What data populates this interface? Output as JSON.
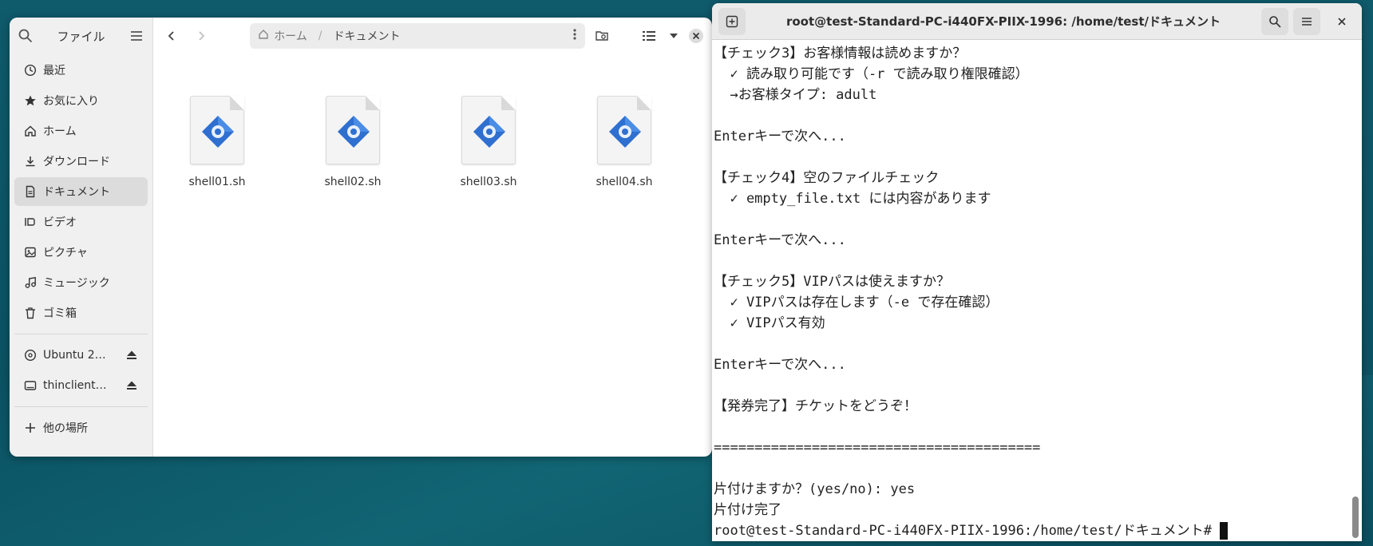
{
  "file_manager": {
    "sidebar": {
      "title": "ファイル",
      "places": [
        {
          "label": "最近",
          "icon": "clock-icon",
          "active": false
        },
        {
          "label": "お気に入り",
          "icon": "star-icon",
          "active": false
        },
        {
          "label": "ホーム",
          "icon": "home-icon",
          "active": false
        },
        {
          "label": "ダウンロード",
          "icon": "download-icon",
          "active": false
        },
        {
          "label": "ドキュメント",
          "icon": "document-icon",
          "active": true
        },
        {
          "label": "ビデオ",
          "icon": "video-icon",
          "active": false
        },
        {
          "label": "ピクチャ",
          "icon": "picture-icon",
          "active": false
        },
        {
          "label": "ミュージック",
          "icon": "music-icon",
          "active": false
        },
        {
          "label": "ゴミ箱",
          "icon": "trash-icon",
          "active": false
        }
      ],
      "devices": [
        {
          "label": "Ubuntu 2…",
          "icon": "disc-icon"
        },
        {
          "label": "thinclient…",
          "icon": "drive-icon"
        }
      ],
      "other_locations": "他の場所"
    },
    "pathbar": {
      "home": "ホーム",
      "current": "ドキュメント"
    },
    "files": [
      {
        "name": "shell01.sh"
      },
      {
        "name": "shell02.sh"
      },
      {
        "name": "shell03.sh"
      },
      {
        "name": "shell04.sh"
      }
    ]
  },
  "terminal": {
    "title": "root@test-Standard-PC-i440FX-PIIX-1996: /home/test/ドキュメント",
    "lines": [
      "【チェック3】お客様情報は読めますか？",
      "  ✓ 読み取り可能です（-r で読み取り権限確認）",
      "  →お客様タイプ: adult",
      "",
      "Enterキーで次へ...",
      "",
      "【チェック4】空のファイルチェック",
      "  ✓ empty_file.txt には内容があります",
      "",
      "Enterキーで次へ...",
      "",
      "【チェック5】VIPパスは使えますか？",
      "  ✓ VIPパスは存在します（-e で存在確認）",
      "  ✓ VIPパス有効",
      "",
      "Enterキーで次へ...",
      "",
      "【発券完了】チケットをどうぞ！",
      "",
      "========================================",
      "",
      "片付けますか？(yes/no): yes",
      "片付け完了"
    ],
    "prompt": "root@test-Standard-PC-i440FX-PIIX-1996:/home/test/ドキュメント# "
  }
}
